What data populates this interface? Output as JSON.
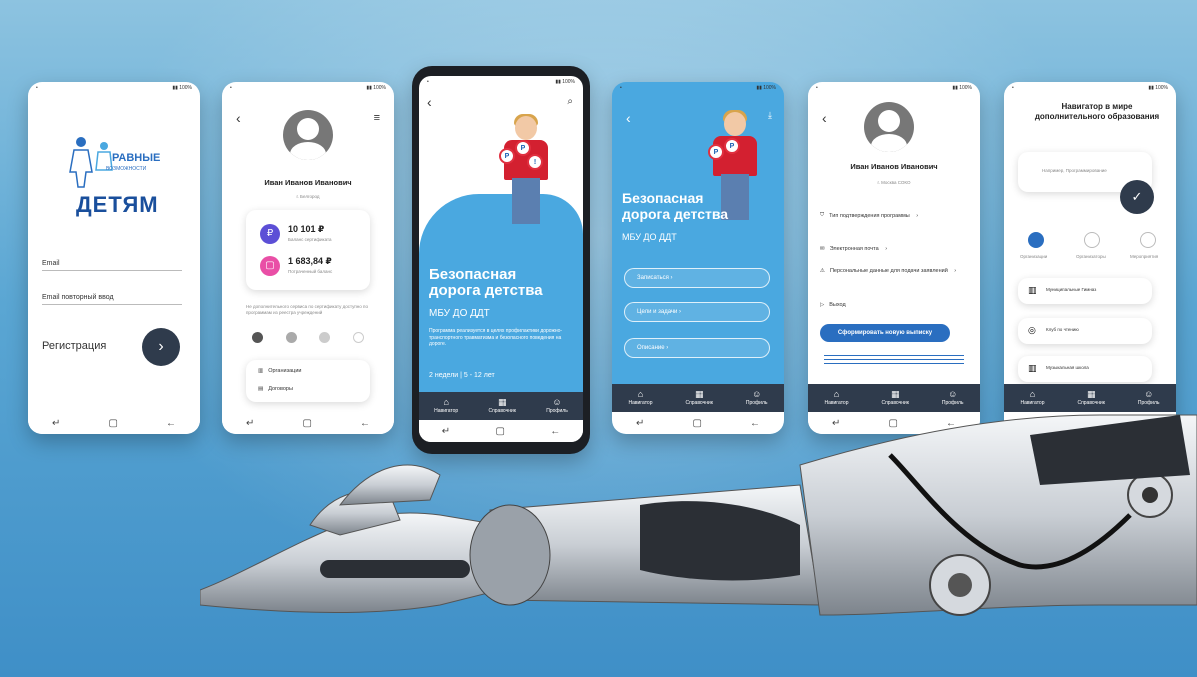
{
  "brand_colors": {
    "accent": "#2a6ec0",
    "tabbar": "#2f3b4c",
    "sky": "#4aa8e0"
  },
  "logo": {
    "line1": "РАВНЫЕ",
    "line2": "ВОЗМОЖНОСТИ",
    "line3": "ДЕТЯМ"
  },
  "registration": {
    "email_label": "Email",
    "email_repeat_label": "Email повторный ввод",
    "register_label": "Регистрация"
  },
  "profile": {
    "name": "Иван Иванов Иванович",
    "city": "г. Белгород",
    "balance1": "10 101 ₽",
    "balance1_caption": "Баланс сертификата",
    "balance2": "1 683,84 ₽",
    "balance2_caption": "Потраченный баланс",
    "note": "Не дополнительного сервиса по сертификату доступно по программам из реестра учреждений",
    "org_label": "Организации",
    "contracts_label": "Договоры"
  },
  "hero": {
    "title_line1": "Безопасная",
    "title_line2": "дорога детства",
    "subtitle": "МБУ ДО ДДТ",
    "desc": "Программа реализуется в целях профилактики дорожно-транспортного травматизма и безопасного поведения на дороге.",
    "duration": "2 недели | 5 - 12 лет"
  },
  "detail": {
    "title_line1": "Безопасная",
    "title_line2": "дорога детства",
    "subtitle": "МБУ ДО ДДТ",
    "buttons": [
      "Записаться",
      "Цели и задачи",
      "Описание"
    ]
  },
  "account": {
    "name": "Иван Иванов Иванович",
    "city": "г. Москва СОКО",
    "menu": [
      "Тип подтверждения программы",
      "Электронная почта",
      "Персональные данные для подачи заявлений",
      "Выход"
    ],
    "cta": "Сформировать новую выписку"
  },
  "navigator": {
    "title": "Навигатор в мире дополнительного образования",
    "input_placeholder": "Например, Программирование",
    "options": [
      "Организации",
      "Организаторы",
      "Мероприятия"
    ],
    "cards": [
      "Муниципальные Гимназ",
      "Клуб по чтению",
      "Музыкальная школа"
    ]
  },
  "tabs": [
    {
      "icon": "home-icon",
      "label": "Навигатор"
    },
    {
      "icon": "book-icon",
      "label": "Справочник"
    },
    {
      "icon": "user-icon",
      "label": "Профиль"
    }
  ],
  "nav_glyphs": {
    "recent": "↵",
    "home": "▢",
    "back": "←"
  }
}
